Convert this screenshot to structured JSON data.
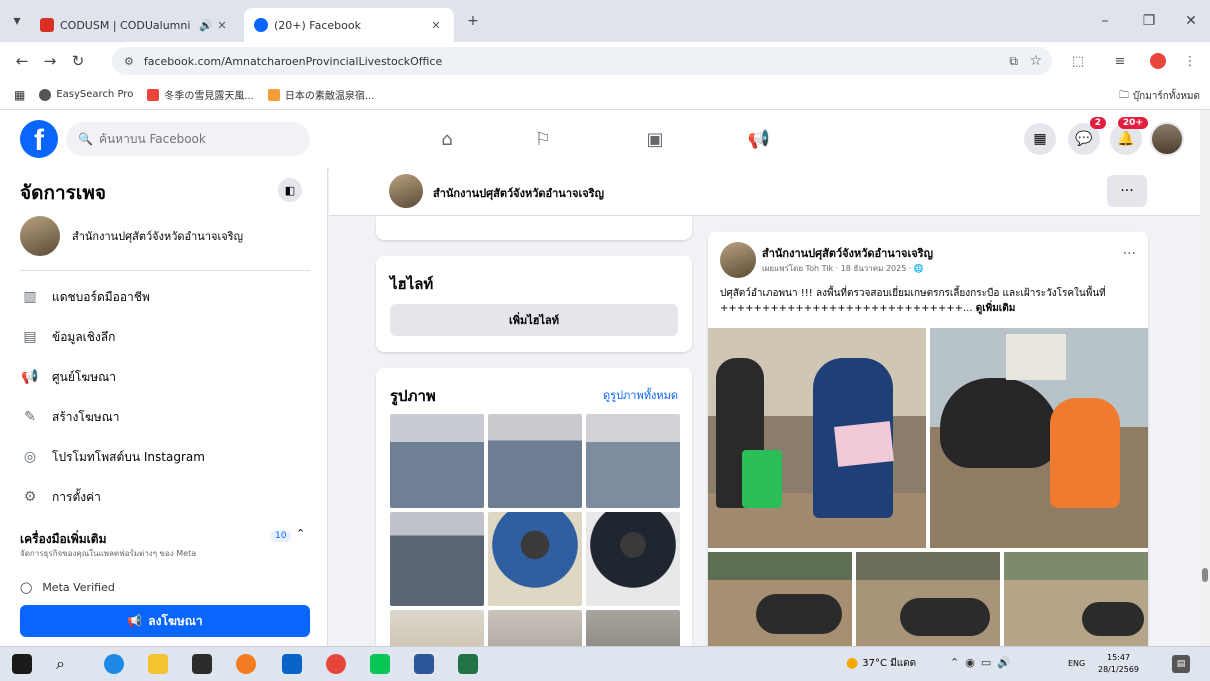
{
  "browser": {
    "tabs": [
      {
        "title": "CODUSM | CODUalumni",
        "active": false,
        "favicon_color": "#d93025"
      },
      {
        "title": "(20+) Facebook",
        "active": true,
        "favicon_color": "#0866ff"
      }
    ],
    "new_tab": "+",
    "window_controls": {
      "minimize": "–",
      "maximize": "❐",
      "close": "✕"
    },
    "url": "facebook.com/AmnatcharoenProvincialLivestockOffice",
    "bookmarks": [
      {
        "label": "EasySearch Pro",
        "color": "#555555"
      },
      {
        "label": "冬季の雪見露天風...",
        "color": "#e8453c"
      },
      {
        "label": "日本の素敵温泉宿...",
        "color": "#f29d38"
      }
    ],
    "bookmarks_folder": "บุ๊กมาร์กทั้งหมด"
  },
  "fb": {
    "search_placeholder": "ค้นหาบน Facebook",
    "messenger_badge": "2",
    "notifications_badge": "20+"
  },
  "sidebar": {
    "title": "จัดการเพจ",
    "page_name": "สำนักงานปศุสัตว์จังหวัดอำนาจเจริญ",
    "items": [
      {
        "label": "แดชบอร์ดมืออาชีพ",
        "icon": "dashboard-icon"
      },
      {
        "label": "ข้อมูลเชิงลึก",
        "icon": "insights-icon"
      },
      {
        "label": "ศูนย์โฆษณา",
        "icon": "megaphone-icon"
      },
      {
        "label": "สร้างโฆษณา",
        "icon": "edit-icon"
      },
      {
        "label": "โปรโมทโพสต์บน Instagram",
        "icon": "instagram-icon"
      },
      {
        "label": "การตั้งค่า",
        "icon": "gear-icon"
      }
    ],
    "tools_title": "เครื่องมือเพิ่มเติม",
    "tools_subtitle": "จัดการธุรกิจของคุณในแพลตฟอร์มต่างๆ ของ Meta",
    "tools_count": "10",
    "meta_verified": "Meta Verified",
    "promote_button": "ลงโฆษณา"
  },
  "main": {
    "page_name": "สำนักงานปศุสัตว์จังหวัดอำนาจเจริญ",
    "intro": {
      "title": "ไฮไลท์",
      "button": "เพิ่มไฮไลท์"
    },
    "photos": {
      "title": "รูปภาพ",
      "see_all": "ดูรูปภาพทั้งหมด",
      "thumbs": [
        "#8c9bb0",
        "#7f90a8",
        "#9aa9bd",
        "#6f7f90",
        "#3d5f8c",
        "#2e3a4a",
        "#b9a98c",
        "#a7a09a",
        "#8f8b82"
      ]
    },
    "post": {
      "author": "สำนักงานปศุสัตว์จังหวัดอำนาจเจริญ",
      "meta": "เผยแพร่โดย Toh Tik · 18 ธันวาคม 2025 · 🌐",
      "text": "ปศุสัตว์อำเภอพนา !!! ลงพื้นที่ตรวจสอบเยี่ยมเกษตรกรเลี้ยงกระบือ และเฝ้าระวังโรคในพื้นที่ +++++++++++++++++++++++++++++... ",
      "see_more": "ดูเพิ่มเติม"
    }
  },
  "taskbar": {
    "weather": "37°C มีแดด",
    "lang": "ENG",
    "time": "15:47",
    "date": "28/1/2569"
  }
}
